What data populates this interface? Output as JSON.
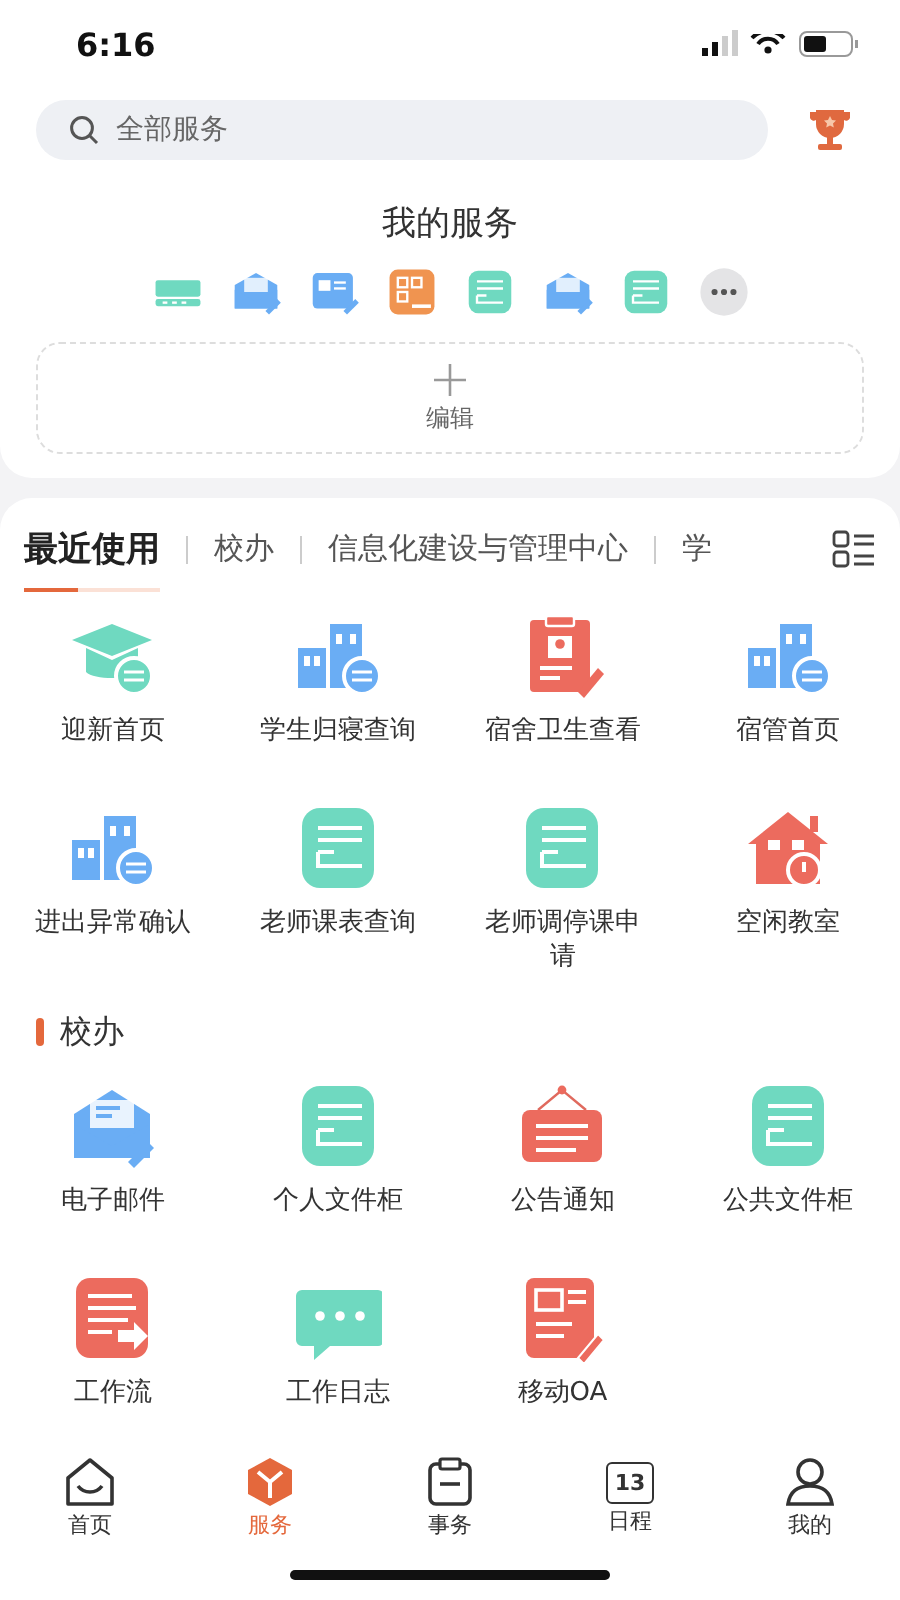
{
  "status_bar": {
    "time": "6:16"
  },
  "search": {
    "placeholder": "全部服务"
  },
  "my_services": {
    "title": "我的服务",
    "icons": [
      {
        "kind": "vpn"
      },
      {
        "kind": "mail"
      },
      {
        "kind": "form"
      },
      {
        "kind": "apps"
      },
      {
        "kind": "doc-hand"
      },
      {
        "kind": "mail"
      },
      {
        "kind": "doc-hand"
      },
      {
        "kind": "more"
      }
    ],
    "edit_label": "编辑"
  },
  "tabs": [
    {
      "label": "最近使用",
      "selected": true
    },
    {
      "label": "校办",
      "selected": false
    },
    {
      "label": "信息化建设与管理中心",
      "selected": false
    },
    {
      "label": "学",
      "selected": false
    }
  ],
  "sections": [
    {
      "items": [
        {
          "label": "迎新首页",
          "kind": "cap"
        },
        {
          "label": "学生归寝查询",
          "kind": "building"
        },
        {
          "label": "宿舍卫生查看",
          "kind": "clipboard"
        },
        {
          "label": "宿管首页",
          "kind": "building"
        },
        {
          "label": "进出异常确认",
          "kind": "building"
        },
        {
          "label": "老师课表查询",
          "kind": "doc-hand"
        },
        {
          "label": "老师调停课申请",
          "kind": "doc-hand"
        },
        {
          "label": "空闲教室",
          "kind": "house"
        }
      ]
    },
    {
      "title": "校办",
      "items": [
        {
          "label": "电子邮件",
          "kind": "mail"
        },
        {
          "label": "个人文件柜",
          "kind": "doc-hand"
        },
        {
          "label": "公告通知",
          "kind": "notice"
        },
        {
          "label": "公共文件柜",
          "kind": "doc-hand"
        },
        {
          "label": "工作流",
          "kind": "workflow"
        },
        {
          "label": "工作日志",
          "kind": "chat"
        },
        {
          "label": "移动OA",
          "kind": "oa"
        }
      ]
    }
  ],
  "nav": [
    {
      "label": "首页",
      "kind": "home",
      "selected": false
    },
    {
      "label": "服务",
      "kind": "cube",
      "selected": true
    },
    {
      "label": "事务",
      "kind": "task",
      "selected": false
    },
    {
      "label": "日程",
      "kind": "calendar",
      "day": "13",
      "selected": false
    },
    {
      "label": "我的",
      "kind": "person",
      "selected": false
    }
  ]
}
